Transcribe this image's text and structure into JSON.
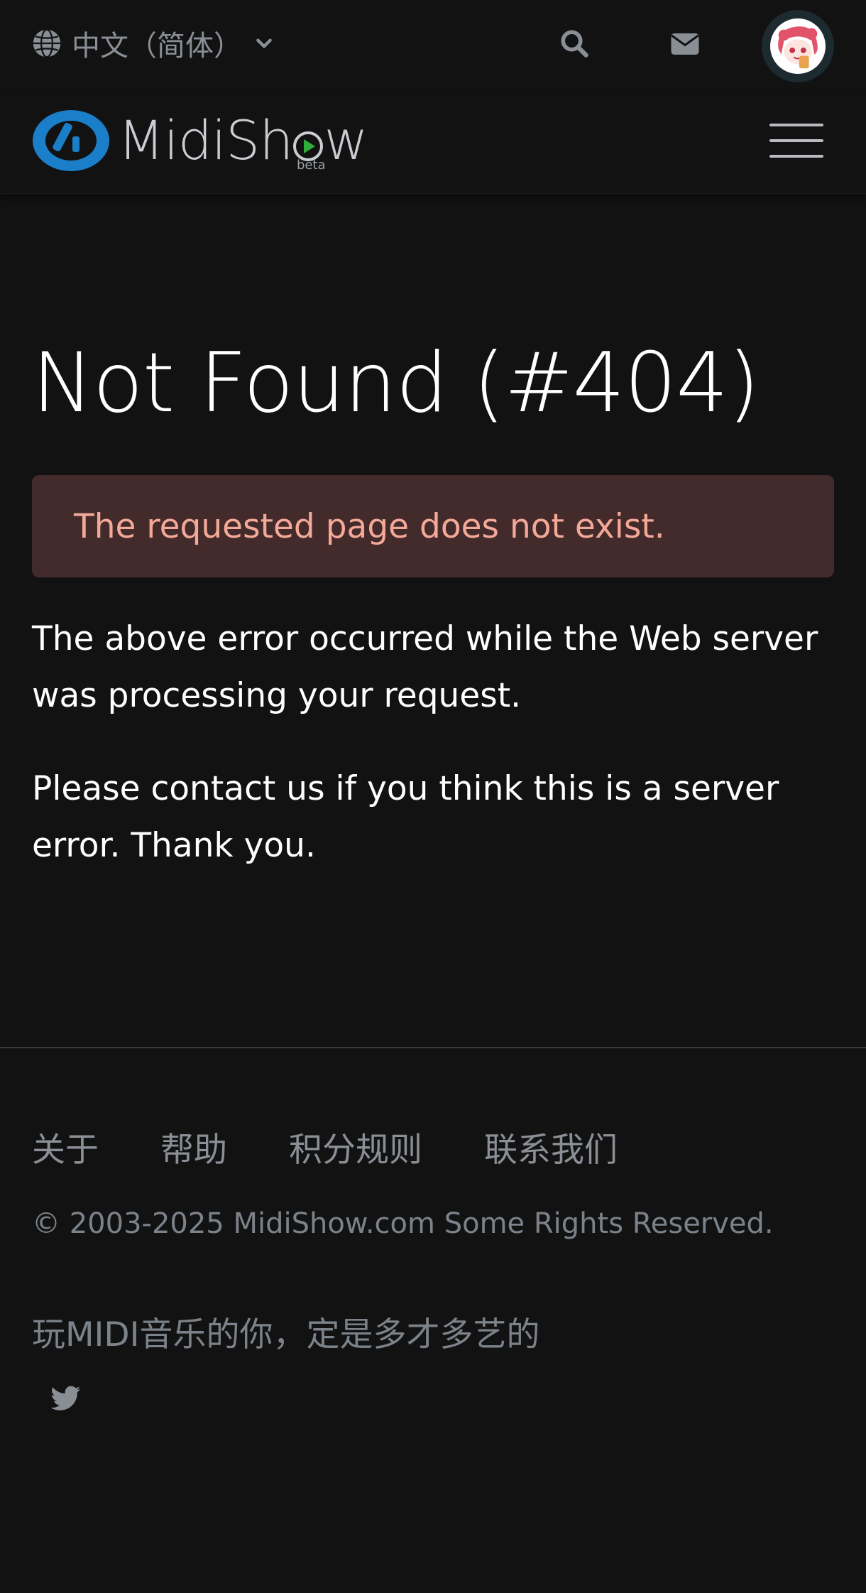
{
  "topbar": {
    "language_label": "中文（简体）",
    "icons": {
      "globe": "globe-icon",
      "chevron": "chevron-down-icon",
      "search": "search-icon",
      "mail": "envelope-icon",
      "avatar": "user-avatar"
    }
  },
  "brand": {
    "name_prefix": "MidiSh",
    "name_suffix": "w",
    "badge": "beta"
  },
  "main": {
    "title": "Not Found (#404)",
    "alert": "The requested page does not exist.",
    "paragraph_1": "The above error occurred while the Web server was processing your request.",
    "paragraph_2": "Please contact us if you think this is a server error. Thank you."
  },
  "footer": {
    "links": [
      "关于",
      "帮助",
      "积分规则",
      "联系我们"
    ],
    "copyright": "© 2003-2025 MidiShow.com Some Rights Reserved.",
    "slogan": "玩MIDI音乐的你，定是多才多艺的",
    "social_icon": "twitter-icon"
  },
  "colors": {
    "background": "#121212",
    "alert_bg": "#432b2b",
    "alert_text": "#f4a898",
    "muted_text": "#8a8f96",
    "logo_blue": "#1a7fc8",
    "logo_green": "#2fae3c"
  }
}
